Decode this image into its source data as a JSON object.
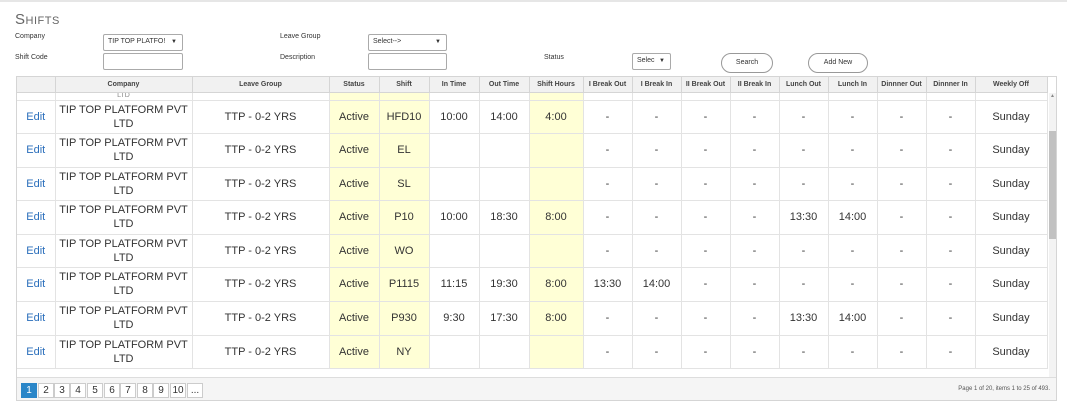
{
  "page": {
    "title": "Shifts"
  },
  "filters": {
    "company_label": "Company",
    "company_value": "TIP TOP PLATFO!",
    "leave_group_label": "Leave Group",
    "leave_group_value": "Select-->",
    "shift_code_label": "Shift Code",
    "description_label": "Description",
    "status_label": "Status",
    "status_value": "Selec",
    "search_button": "Search",
    "add_new_button": "Add New"
  },
  "table": {
    "columns": [
      "",
      "Company",
      "Leave Group",
      "Status",
      "Shift",
      "In Time",
      "Out Time",
      "Shift Hours",
      "I Break Out",
      "I Break In",
      "II Break Out",
      "II Break In",
      "Lunch Out",
      "Lunch In",
      "Dinnner Out",
      "Dinnner In",
      "Weekly Off"
    ],
    "clipped_row_text": "LTD",
    "rows": [
      {
        "edit": "Edit",
        "company": "TIP TOP PLATFORM PVT LTD",
        "leave_group": "TTP - 0-2 YRS",
        "status": "Active",
        "shift": "HFD10",
        "in_time": "10:00",
        "out_time": "14:00",
        "shift_hours": "4:00",
        "b1_out": "-",
        "b1_in": "-",
        "b2_out": "-",
        "b2_in": "-",
        "lunch_out": "-",
        "lunch_in": "-",
        "dinner_out": "-",
        "dinner_in": "-",
        "weekly_off": "Sunday"
      },
      {
        "edit": "Edit",
        "company": "TIP TOP PLATFORM PVT LTD",
        "leave_group": "TTP - 0-2 YRS",
        "status": "Active",
        "shift": "EL",
        "in_time": "",
        "out_time": "",
        "shift_hours": "",
        "b1_out": "-",
        "b1_in": "-",
        "b2_out": "-",
        "b2_in": "-",
        "lunch_out": "-",
        "lunch_in": "-",
        "dinner_out": "-",
        "dinner_in": "-",
        "weekly_off": "Sunday"
      },
      {
        "edit": "Edit",
        "company": "TIP TOP PLATFORM PVT LTD",
        "leave_group": "TTP - 0-2 YRS",
        "status": "Active",
        "shift": "SL",
        "in_time": "",
        "out_time": "",
        "shift_hours": "",
        "b1_out": "-",
        "b1_in": "-",
        "b2_out": "-",
        "b2_in": "-",
        "lunch_out": "-",
        "lunch_in": "-",
        "dinner_out": "-",
        "dinner_in": "-",
        "weekly_off": "Sunday"
      },
      {
        "edit": "Edit",
        "company": "TIP TOP PLATFORM PVT LTD",
        "leave_group": "TTP - 0-2 YRS",
        "status": "Active",
        "shift": "P10",
        "in_time": "10:00",
        "out_time": "18:30",
        "shift_hours": "8:00",
        "b1_out": "-",
        "b1_in": "-",
        "b2_out": "-",
        "b2_in": "-",
        "lunch_out": "13:30",
        "lunch_in": "14:00",
        "dinner_out": "-",
        "dinner_in": "-",
        "weekly_off": "Sunday"
      },
      {
        "edit": "Edit",
        "company": "TIP TOP PLATFORM PVT LTD",
        "leave_group": "TTP - 0-2 YRS",
        "status": "Active",
        "shift": "WO",
        "in_time": "",
        "out_time": "",
        "shift_hours": "",
        "b1_out": "-",
        "b1_in": "-",
        "b2_out": "-",
        "b2_in": "-",
        "lunch_out": "-",
        "lunch_in": "-",
        "dinner_out": "-",
        "dinner_in": "-",
        "weekly_off": "Sunday"
      },
      {
        "edit": "Edit",
        "company": "TIP TOP PLATFORM PVT LTD",
        "leave_group": "TTP - 0-2 YRS",
        "status": "Active",
        "shift": "P1115",
        "in_time": "11:15",
        "out_time": "19:30",
        "shift_hours": "8:00",
        "b1_out": "13:30",
        "b1_in": "14:00",
        "b2_out": "-",
        "b2_in": "-",
        "lunch_out": "-",
        "lunch_in": "-",
        "dinner_out": "-",
        "dinner_in": "-",
        "weekly_off": "Sunday"
      },
      {
        "edit": "Edit",
        "company": "TIP TOP PLATFORM PVT LTD",
        "leave_group": "TTP - 0-2 YRS",
        "status": "Active",
        "shift": "P930",
        "in_time": "9:30",
        "out_time": "17:30",
        "shift_hours": "8:00",
        "b1_out": "-",
        "b1_in": "-",
        "b2_out": "-",
        "b2_in": "-",
        "lunch_out": "13:30",
        "lunch_in": "14:00",
        "dinner_out": "-",
        "dinner_in": "-",
        "weekly_off": "Sunday"
      },
      {
        "edit": "Edit",
        "company": "TIP TOP PLATFORM PVT LTD",
        "leave_group": "TTP - 0-2 YRS",
        "status": "Active",
        "shift": "NY",
        "in_time": "",
        "out_time": "",
        "shift_hours": "",
        "b1_out": "-",
        "b1_in": "-",
        "b2_out": "-",
        "b2_in": "-",
        "lunch_out": "-",
        "lunch_in": "-",
        "dinner_out": "-",
        "dinner_in": "-",
        "weekly_off": "Sunday"
      }
    ]
  },
  "pager": {
    "pages": [
      "1",
      "2",
      "3",
      "4",
      "5",
      "6",
      "7",
      "8",
      "9",
      "10",
      "..."
    ],
    "active_page": "1",
    "info": "Page 1 of 20, items 1 to 25 of 493."
  },
  "colors": {
    "highlight": "#ffffd6",
    "link": "#2a6ebb",
    "active_page": "#2a86c8"
  }
}
